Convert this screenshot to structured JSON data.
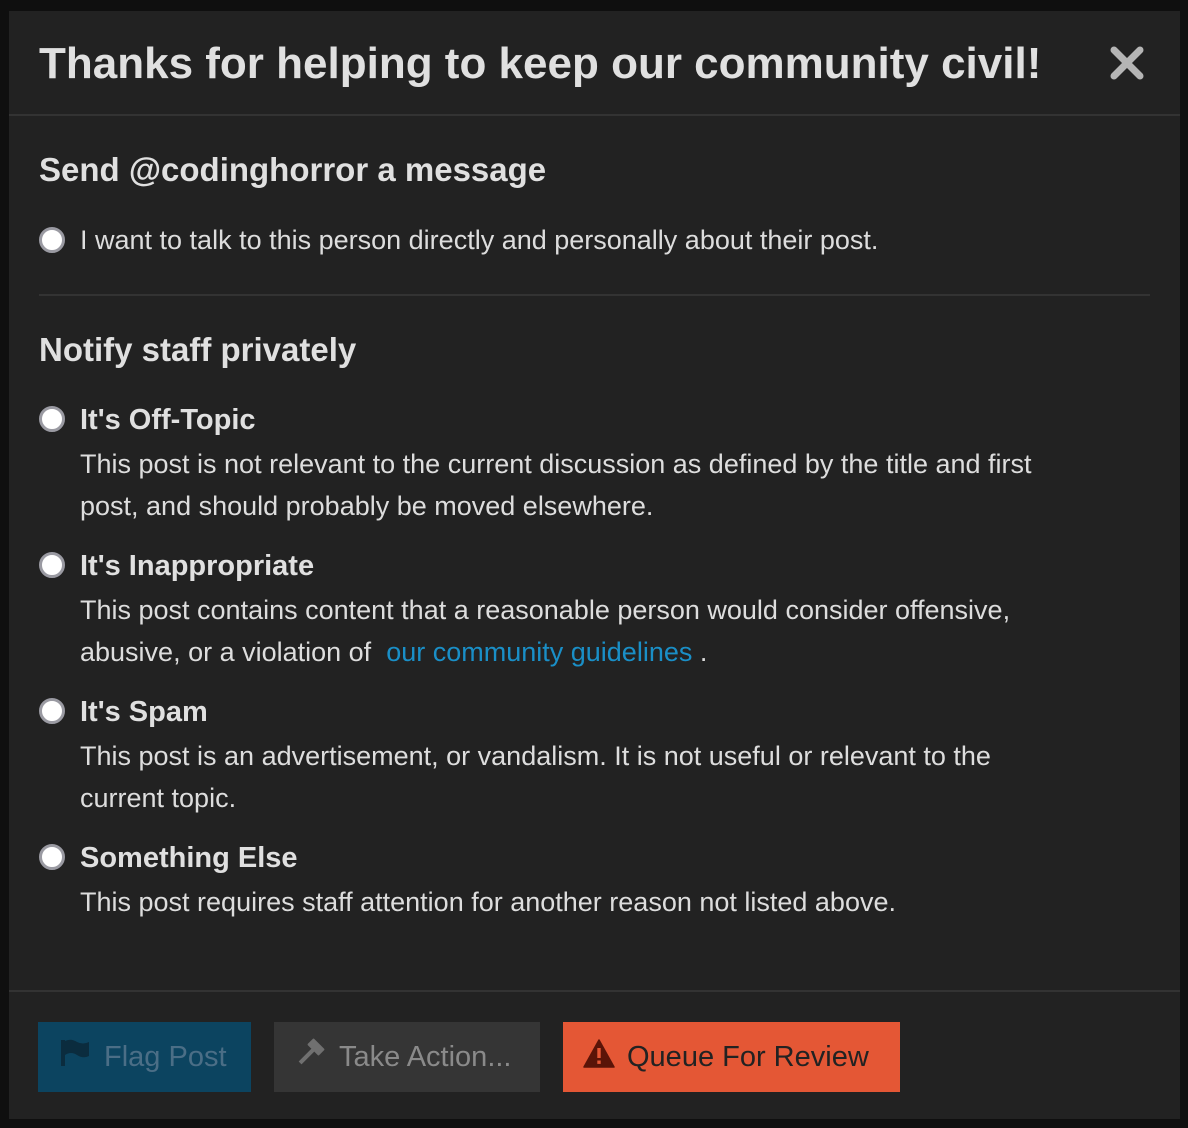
{
  "modal": {
    "title": "Thanks for helping to keep our community civil!",
    "close_icon": "close-icon"
  },
  "message_section": {
    "title": "Send @codinghorror a message",
    "option_text": "I want to talk to this person directly and personally about their post."
  },
  "staff_section": {
    "title": "Notify staff privately",
    "options": [
      {
        "label": "It's Off-Topic",
        "description": "This post is not relevant to the current discussion as defined by the title and first post, and should probably be moved elsewhere."
      },
      {
        "label": "It's Inappropriate",
        "description": "This post contains content that a reasonable person would consider offensive, abusive, or a violation of",
        "link_text": "our community guidelines",
        "description_end": "."
      },
      {
        "label": "It's Spam",
        "description": "This post is an advertisement, or vandalism. It is not useful or relevant to the current topic."
      },
      {
        "label": "Something Else",
        "description": "This post requires staff attention for another reason not listed above."
      }
    ]
  },
  "footer": {
    "flag_post_label": "Flag Post",
    "take_action_label": "Take Action...",
    "queue_review_label": "Queue For Review"
  },
  "icons": {
    "flag": "flag-icon",
    "gavel": "gavel-icon",
    "warning": "warning-icon"
  },
  "colors": {
    "modal_bg": "#222222",
    "link": "#1a8fc7",
    "flag_button_bg": "#0c4460",
    "take_action_bg": "#353535",
    "queue_button_bg": "#e45735"
  }
}
